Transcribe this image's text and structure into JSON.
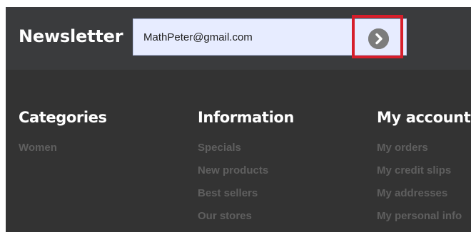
{
  "newsletter": {
    "title": "Newsletter",
    "email_value": "MathPeter@gmail.com",
    "submit_icon": "chevron-right-circle-icon",
    "highlight_color": "#d61e2b"
  },
  "footer": {
    "categories": {
      "heading": "Categories",
      "links": [
        "Women"
      ]
    },
    "information": {
      "heading": "Information",
      "links": [
        "Specials",
        "New products",
        "Best sellers",
        "Our stores"
      ]
    },
    "my_account": {
      "heading": "My account",
      "links": [
        "My orders",
        "My credit slips",
        "My addresses",
        "My personal info"
      ]
    }
  },
  "colors": {
    "newsletter_bg": "#3a3b3d",
    "footer_bg": "#333333",
    "input_bg": "#e7ecff",
    "link_color": "#5f5f5f"
  }
}
